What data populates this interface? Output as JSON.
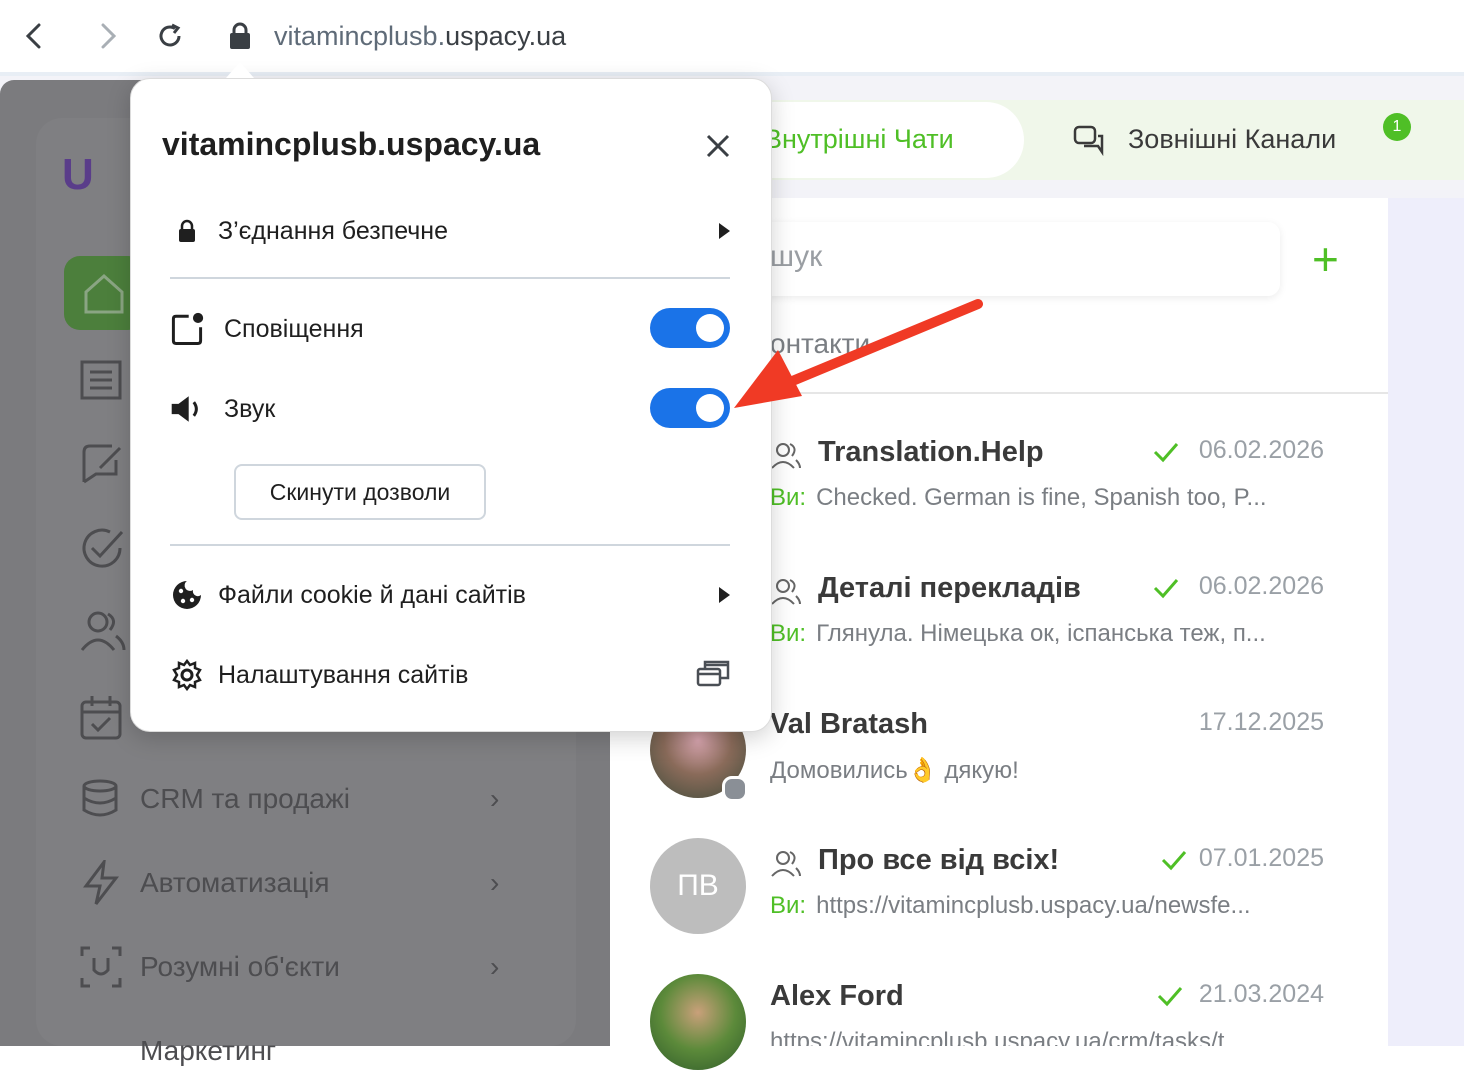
{
  "browser": {
    "url_prefix": "vitamincplusb.",
    "url_domain": "uspacy.ua"
  },
  "app": {
    "logo_text": "U",
    "tabs": [
      {
        "label": "Внутрішні Чати"
      },
      {
        "label": "Зовнішні Канали",
        "badge": "1"
      }
    ],
    "search_placeholder": "шук",
    "contacts_tab": "онтакти",
    "sidebar": [
      {
        "label": "CRM та продажі"
      },
      {
        "label": "Автоматизація"
      },
      {
        "label": "Розумні об'єкти"
      },
      {
        "label": "Маркетинг"
      }
    ],
    "chats": [
      {
        "name": "Translation.Help",
        "date": "06.02.2026",
        "you": "Ви:",
        "preview": "Checked. German is fine, Spanish too, P..."
      },
      {
        "name": "Деталі перекладів",
        "date": "06.02.2026",
        "you": "Ви:",
        "preview": "Глянула. Німецька ок, іспанська теж, п..."
      },
      {
        "name": "Val Bratash",
        "date": "17.12.2025",
        "preview": "Домовились👌 дякую!"
      },
      {
        "name": "Про все від всіх!",
        "date": "07.01.2025",
        "you": "Ви:",
        "preview": "https://vitamincplusb.uspacy.ua/newsfe...",
        "initials": "ПВ"
      },
      {
        "name": "Alex Ford",
        "date": "21.03.2024",
        "preview": "https://vitamincplusb.uspacy.ua/crm/tasks/t..."
      }
    ]
  },
  "popup": {
    "title": "vitamincplusb.uspacy.ua",
    "connection": "З’єднання безпечне",
    "notifications": "Сповіщення",
    "notifications_on": true,
    "sound": "Звук",
    "sound_on": true,
    "reset_button": "Скинути дозволи",
    "cookies": "Файли cookie й дані сайтів",
    "site_settings": "Налаштування сайтів"
  },
  "colors": {
    "accent_green": "#4fbf26",
    "toggle_blue": "#1a73e8",
    "arrow_red": "#f03a25"
  }
}
